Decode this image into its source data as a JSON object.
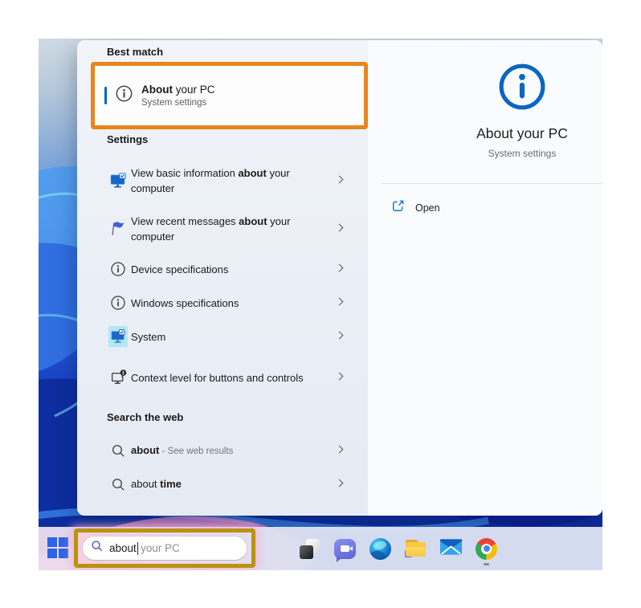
{
  "panel": {
    "best_match_label": "Best match",
    "best_match": {
      "title_bold": "About",
      "title_rest": " your PC",
      "subtitle": "System settings"
    },
    "settings_label": "Settings",
    "settings_items": [
      {
        "pre": "View basic information ",
        "bold": "about",
        "post": " your computer"
      },
      {
        "pre": "View recent messages ",
        "bold": "about",
        "post": " your computer"
      },
      {
        "pre": "Device specifications",
        "bold": "",
        "post": ""
      },
      {
        "pre": "Windows specifications",
        "bold": "",
        "post": ""
      },
      {
        "pre": "System",
        "bold": "",
        "post": ""
      },
      {
        "pre": "Context level for buttons and controls",
        "bold": "",
        "post": ""
      }
    ],
    "web_label": "Search the web",
    "web_items": [
      {
        "pre": "",
        "bold": "about",
        "post": "",
        "note": " - See web results"
      },
      {
        "pre": "about ",
        "bold": "time",
        "post": "",
        "note": ""
      }
    ]
  },
  "detail": {
    "title": "About your PC",
    "subtitle": "System settings",
    "open_label": "Open"
  },
  "taskbar": {
    "search_typed": "about",
    "search_suggestion": "your PC"
  },
  "colors": {
    "highlight_orange": "#E8861D",
    "highlight_gold": "#B8930E",
    "accent_blue": "#0067C0",
    "info_blue": "#0B66C1"
  }
}
